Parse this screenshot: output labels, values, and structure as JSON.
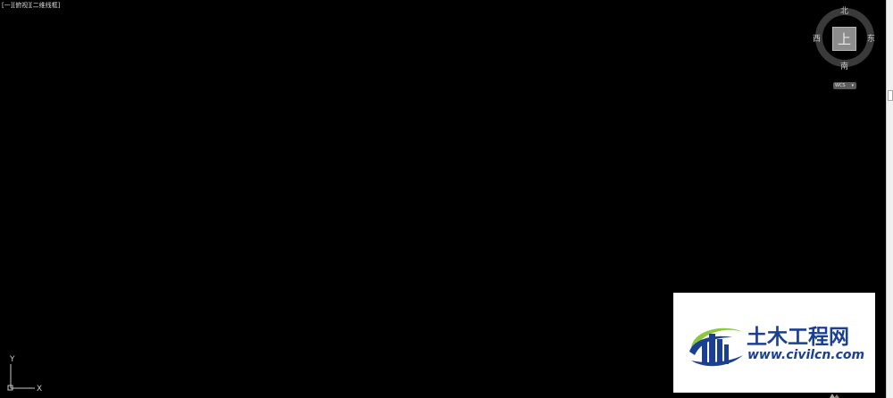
{
  "viewport": {
    "label": "[一][俯视][二维线框]",
    "background_color": "#000000"
  },
  "viewcube": {
    "face_label": "上",
    "north": "北",
    "south": "南",
    "west": "西",
    "east": "东",
    "coordinate_system": "WCS",
    "menu_caret": "▾"
  },
  "ucs_icon": {
    "x_label": "X",
    "y_label": "Y"
  },
  "watermark": {
    "title": "土木工程网",
    "url": "www.civilcn.com",
    "brand_color": "#1b3f91",
    "accent_color": "#8dc63f"
  },
  "icons": [
    "viewcube-icon",
    "compass-ring-icon",
    "ucs-icon",
    "civilcn-logo-icon"
  ]
}
